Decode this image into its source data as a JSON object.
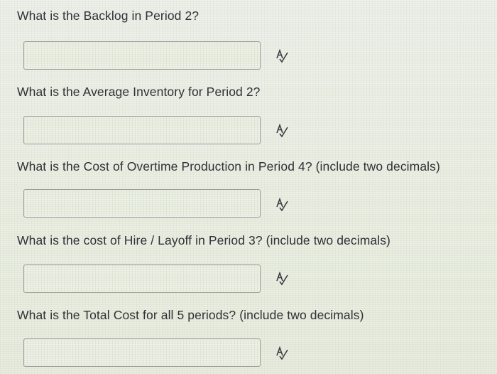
{
  "questions": [
    {
      "text": "What is the Backlog in Period 2?",
      "value": "",
      "icon": "spellcheck-icon"
    },
    {
      "text": "What is the Average Inventory for Period 2?",
      "value": "",
      "icon": "spellcheck-icon"
    },
    {
      "text": "What is the Cost of Overtime Production in Period 4? (include two decimals)",
      "value": "",
      "icon": "spellcheck-icon"
    },
    {
      "text": "What is the cost of Hire / Layoff in Period 3? (include two decimals)",
      "value": "",
      "icon": "spellcheck-icon"
    },
    {
      "text": "What is the Total Cost for all 5 periods? (include two decimals)",
      "value": "",
      "icon": "spellcheck-icon"
    }
  ]
}
